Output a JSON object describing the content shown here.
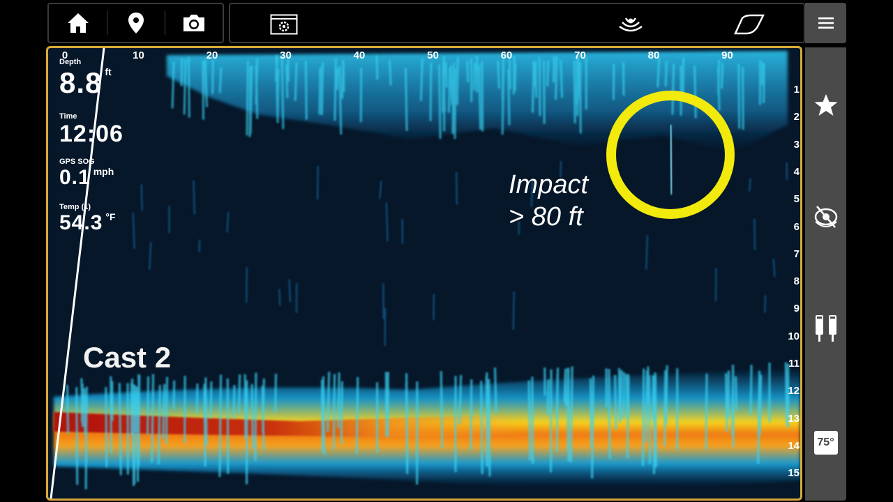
{
  "topbar": {
    "home_icon": "home-icon",
    "waypoint_icon": "map-pin-icon",
    "camera_icon": "camera-icon",
    "settings_icon": "settings-gear-icon",
    "sonar_icon": "sonar-ping-icon",
    "boat_icon": "boat-hull-icon",
    "menu_icon": "hamburger-menu-icon"
  },
  "scale": {
    "horizontal": [
      "0",
      "10",
      "20",
      "30",
      "40",
      "50",
      "60",
      "70",
      "80",
      "90"
    ],
    "vertical": [
      "1",
      "2",
      "3",
      "4",
      "5",
      "6",
      "7",
      "8",
      "9",
      "10",
      "11",
      "12",
      "13",
      "14",
      "15"
    ]
  },
  "readouts": {
    "depth": {
      "label": "Depth",
      "value": "8.8",
      "unit": "ft"
    },
    "time": {
      "label": "Time",
      "value": "12:06"
    },
    "sog": {
      "label": "GPS SOG",
      "value": "0.1",
      "unit": "mph"
    },
    "temp": {
      "label": "Temp (1)",
      "value": "54.3",
      "unit": "°F"
    }
  },
  "overlay": {
    "cast_label": "Cast 2",
    "impact_line1": "Impact",
    "impact_line2": "> 80 ft"
  },
  "sidebar": {
    "favorite_icon": "star-icon",
    "livescope_icon": "transducer-eye-icon",
    "split_icon": "dual-transducer-icon",
    "temp_badge": "75°"
  },
  "colors": {
    "panel_border": "#d8a93a",
    "water": "#06172a",
    "bottom_hot": "#b0120a",
    "bottom_warm": "#f5a21e",
    "return_cyan": "#19a8e0",
    "impact_circle": "#f2ea0c",
    "chrome": "#4a4a4a"
  }
}
